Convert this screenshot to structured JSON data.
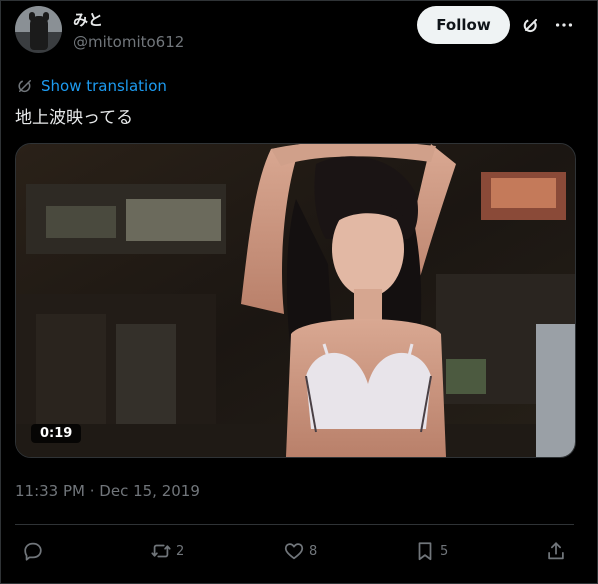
{
  "author": {
    "display_name": "みと",
    "handle": "@mitomito612"
  },
  "header": {
    "follow_label": "Follow",
    "grok_icon": "grok-icon",
    "more_icon": "more-icon"
  },
  "translation": {
    "label": "Show translation"
  },
  "tweet": {
    "text": "地上波映ってる",
    "timestamp": "11:33 PM · Dec 15, 2019"
  },
  "media": {
    "duration": "0:19"
  },
  "actions": {
    "replies": "",
    "reposts": "2",
    "likes": "8",
    "bookmarks": "5"
  },
  "colors": {
    "background": "#000000",
    "text": "#e7e9ea",
    "muted": "#71767b",
    "accent": "#1d9bf0",
    "border": "#2f3336",
    "follow_bg": "#eff3f4"
  }
}
